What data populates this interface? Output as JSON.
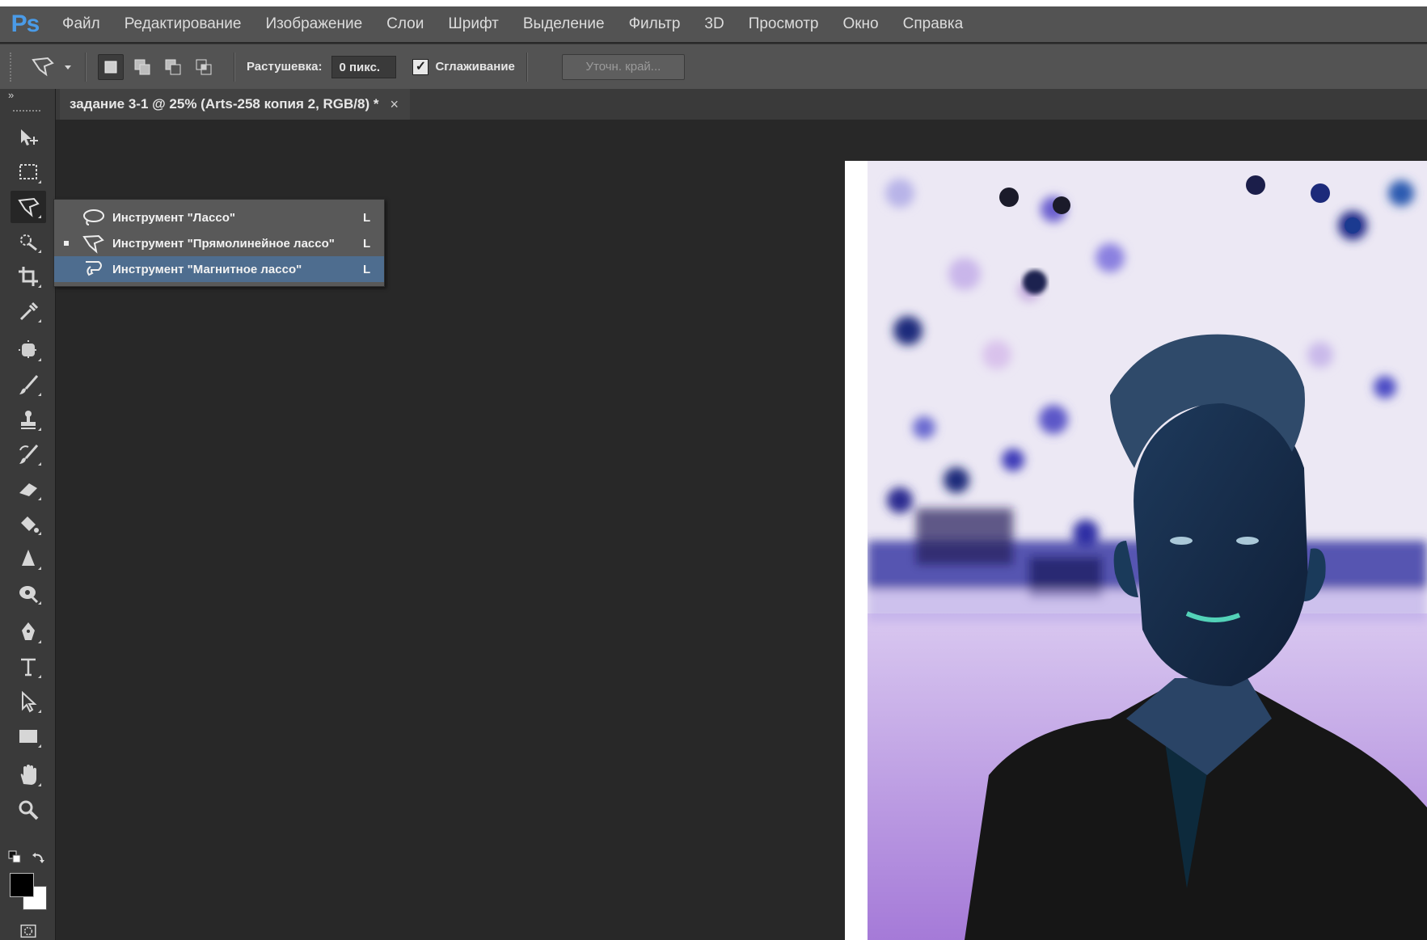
{
  "app": {
    "logo": "Ps"
  },
  "menu": [
    "Файл",
    "Редактирование",
    "Изображение",
    "Слои",
    "Шрифт",
    "Выделение",
    "Фильтр",
    "3D",
    "Просмотр",
    "Окно",
    "Справка"
  ],
  "options": {
    "feather_label": "Растушевка:",
    "feather_value": "0 пикс.",
    "antialias_label": "Сглаживание",
    "antialias_checked": true,
    "refine_edge_label": "Уточн. край..."
  },
  "document_tab": {
    "title": "задание 3-1 @ 25% (Arts-258 копия 2, RGB/8) *",
    "close": "×"
  },
  "toolbar": {
    "collapse_label": "»",
    "tools": [
      {
        "name": "move-tool-icon"
      },
      {
        "name": "marquee-tool-icon"
      },
      {
        "name": "polygonal-lasso-tool-icon",
        "active": true
      },
      {
        "name": "quick-selection-tool-icon"
      },
      {
        "name": "crop-tool-icon"
      },
      {
        "name": "eyedropper-tool-icon"
      },
      {
        "name": "spot-healing-tool-icon"
      },
      {
        "name": "brush-tool-icon"
      },
      {
        "name": "clone-stamp-tool-icon"
      },
      {
        "name": "history-brush-tool-icon"
      },
      {
        "name": "eraser-tool-icon"
      },
      {
        "name": "paint-bucket-tool-icon"
      },
      {
        "name": "blur-tool-icon"
      },
      {
        "name": "dodge-tool-icon"
      },
      {
        "name": "pen-tool-icon"
      },
      {
        "name": "type-tool-icon"
      },
      {
        "name": "path-selection-tool-icon"
      },
      {
        "name": "rectangle-tool-icon"
      },
      {
        "name": "hand-tool-icon"
      },
      {
        "name": "zoom-tool-icon"
      }
    ]
  },
  "flyout": {
    "items": [
      {
        "label": "Инструмент \"Лассо\"",
        "key": "L",
        "current": false,
        "highlighted": false
      },
      {
        "label": "Инструмент \"Прямолинейное лассо\"",
        "key": "L",
        "current": true,
        "highlighted": false
      },
      {
        "label": "Инструмент \"Магнитное лассо\"",
        "key": "L",
        "current": false,
        "highlighted": true
      }
    ]
  },
  "colors": {
    "foreground": "#000000",
    "background": "#ffffff",
    "accent": "#4a9be8",
    "highlight": "#4e6d8f"
  }
}
